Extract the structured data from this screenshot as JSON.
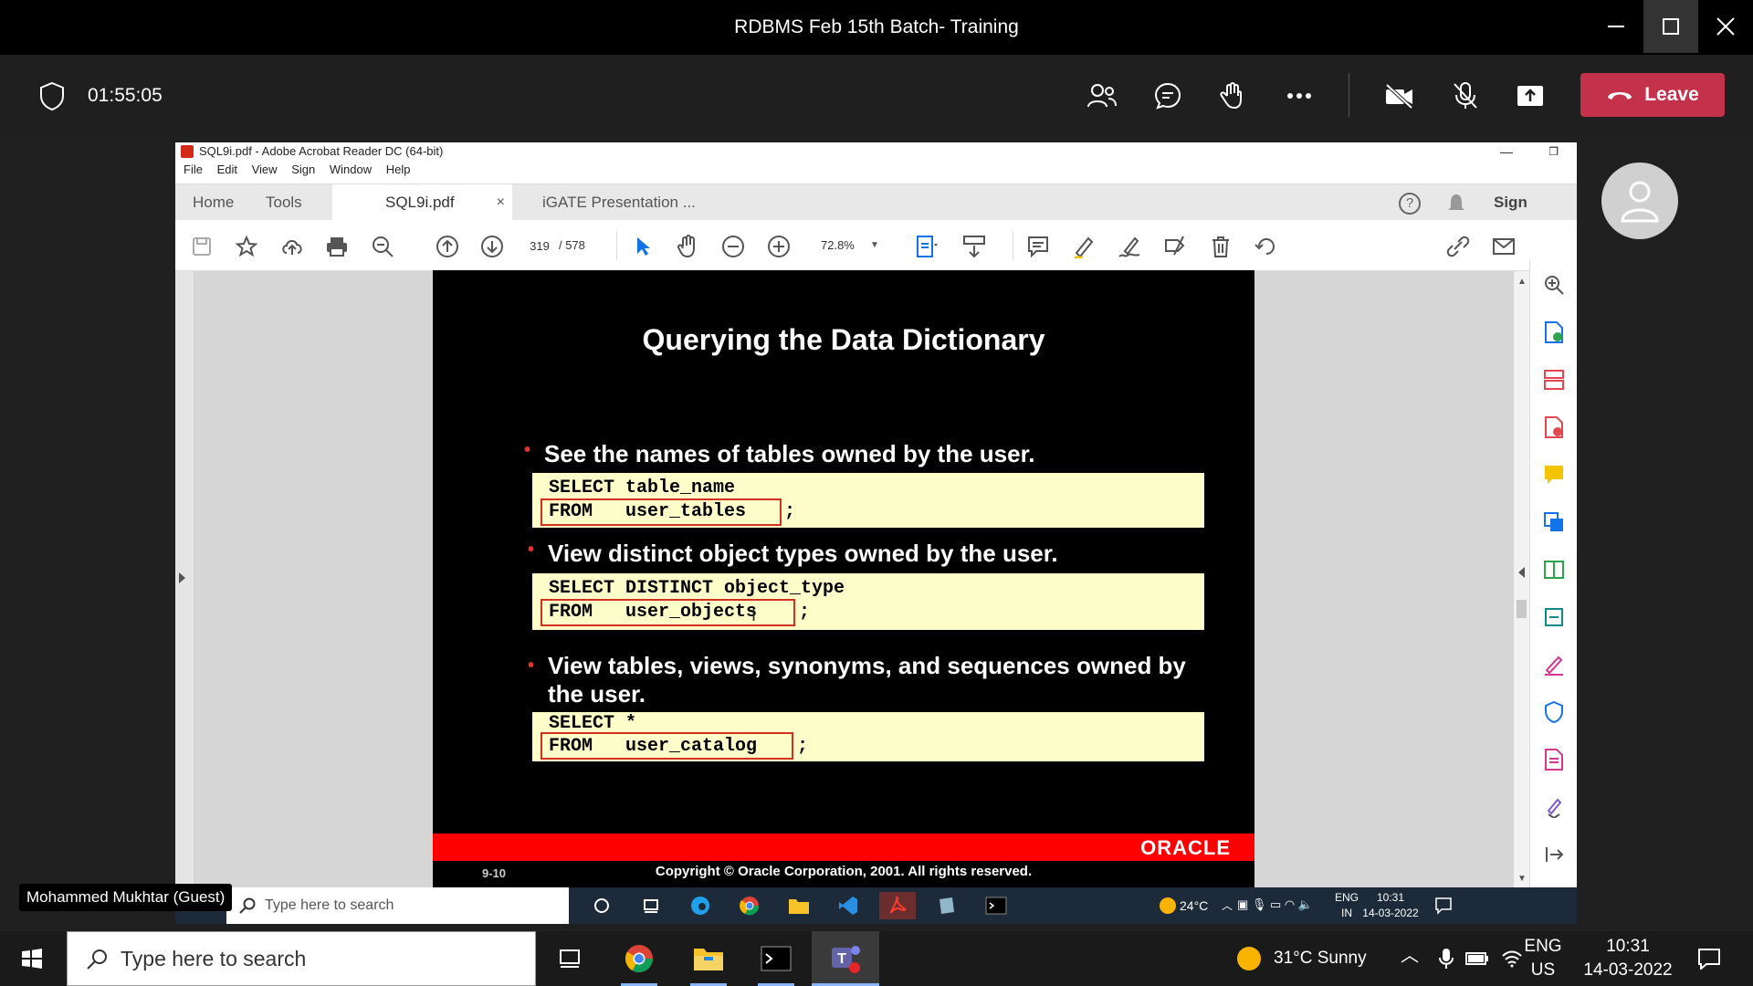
{
  "window": {
    "title": "RDBMS Feb 15th Batch- Training"
  },
  "meeting": {
    "elapsed": "01:55:05",
    "leave_label": "Leave"
  },
  "acrobat": {
    "title": "SQL9i.pdf - Adobe Acrobat Reader DC (64-bit)",
    "menu": [
      "File",
      "Edit",
      "View",
      "Sign",
      "Window",
      "Help"
    ],
    "tabs": {
      "home": "Home",
      "tools": "Tools",
      "doc": "SQL9i.pdf",
      "doc2": "iGATE Presentation ...",
      "sign": "Sign"
    },
    "page_current": "319",
    "page_total": "/ 578",
    "zoom": "72.8%"
  },
  "slide": {
    "title": "Querying the Data Dictionary",
    "bullets": [
      "See the names of tables owned by the user.",
      "View distinct object types owned by the user.",
      "View tables, views, synonyms, and sequences owned by",
      "the user."
    ],
    "code1": [
      "SELECT table_name",
      "FROM   user_tables",
      ";"
    ],
    "code2": [
      "SELECT DISTINCT object_type",
      "FROM   user_objects",
      ";"
    ],
    "code3": [
      "SELECT *",
      "FROM   user_catalog",
      ";"
    ],
    "brand": "ORACLE",
    "slide_number": "9-10",
    "copyright": "Copyright © Oracle Corporation, 2001. All rights reserved."
  },
  "participant": {
    "name": "Mohammed Mukhtar (Guest)"
  },
  "inner_taskbar": {
    "search_placeholder": "Type here to search",
    "weather": "24°C",
    "lang": "ENG",
    "region": "IN",
    "time": "10:31",
    "date": "14-03-2022"
  },
  "taskbar": {
    "search_placeholder": "Type here to search",
    "weather": "31°C  Sunny",
    "lang": "ENG",
    "region": "US",
    "time": "10:31",
    "date": "14-03-2022"
  }
}
